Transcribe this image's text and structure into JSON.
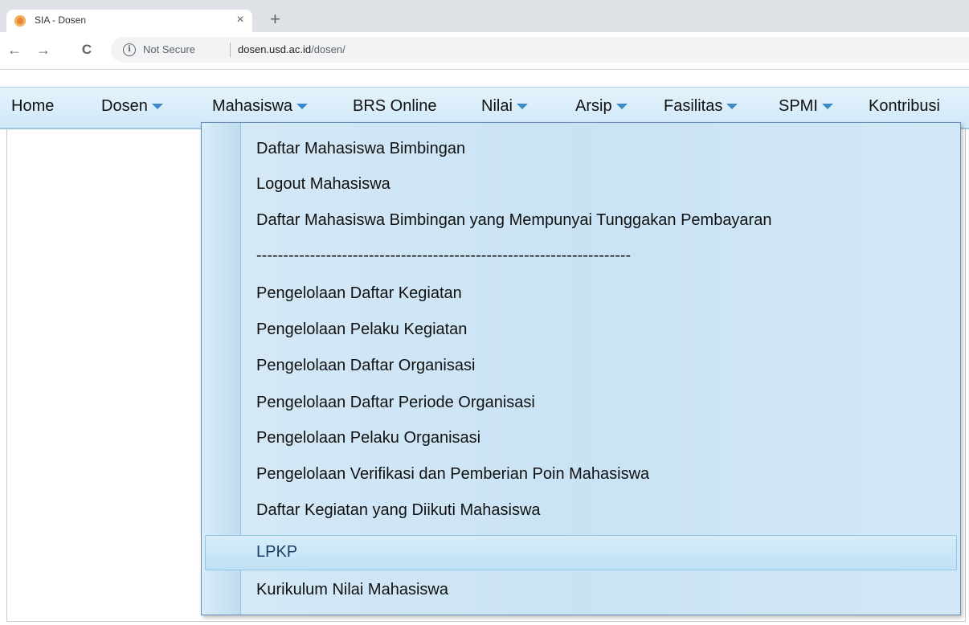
{
  "browser": {
    "tab": {
      "title": "SIA - Dosen",
      "close_glyph": "×"
    },
    "new_tab_glyph": "+",
    "nav": {
      "back": "←",
      "forward": "→",
      "reload": "C"
    },
    "address_bar": {
      "security_label": "Not Secure",
      "url_host": "dosen.usd.ac.id",
      "url_path": "/dosen/"
    }
  },
  "menubar": {
    "items": [
      {
        "label": "Home",
        "has_caret": false
      },
      {
        "label": "Dosen",
        "has_caret": true
      },
      {
        "label": "Mahasiswa",
        "has_caret": true
      },
      {
        "label": "BRS Online",
        "has_caret": false
      },
      {
        "label": "Nilai",
        "has_caret": true
      },
      {
        "label": "Arsip",
        "has_caret": true
      },
      {
        "label": "Fasilitas",
        "has_caret": true
      },
      {
        "label": "SPMI",
        "has_caret": true
      },
      {
        "label": "Kontribusi",
        "has_caret": false
      }
    ],
    "caret_color": "#3d88c6"
  },
  "dropdown": {
    "parent": "Mahasiswa",
    "items": [
      "Daftar Mahasiswa Bimbingan",
      "Logout Mahasiswa",
      "Daftar Mahasiswa Bimbingan yang Mempunyai Tunggakan Pembayaran",
      "----------------------------------------------------------------------",
      "Pengelolaan Daftar Kegiatan",
      "Pengelolaan Pelaku Kegiatan",
      "Pengelolaan Daftar Organisasi",
      "Pengelolaan Daftar Periode Organisasi",
      "Pengelolaan Pelaku Organisasi",
      "Pengelolaan Verifikasi dan Pemberian Poin Mahasiswa",
      "Daftar Kegiatan yang Diikuti Mahasiswa",
      "LPKP",
      "Kurikulum Nilai Mahasiswa"
    ],
    "highlighted_item": "LPKP"
  },
  "colors": {
    "menubar_bg": "#d7ecfa",
    "dropdown_bg": "#cfe6f6",
    "highlight_border": "#8fc6e4"
  }
}
